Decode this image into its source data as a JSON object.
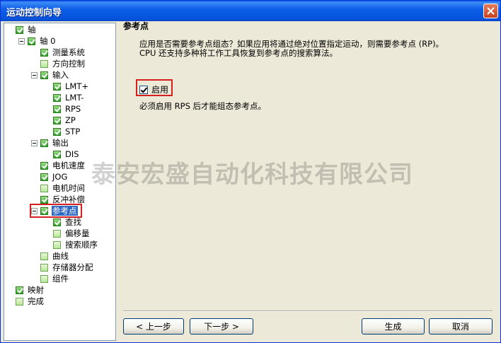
{
  "window": {
    "title": "运动控制向导"
  },
  "tree": [
    {
      "label": "轴",
      "checked": true,
      "depth": 0
    },
    {
      "label": "轴 0",
      "checked": true,
      "depth": 1
    },
    {
      "label": "测量系统",
      "checked": true,
      "depth": 2
    },
    {
      "label": "方向控制",
      "checked": false,
      "depth": 2
    },
    {
      "label": "输入",
      "checked": true,
      "depth": 2
    },
    {
      "label": "LMT+",
      "checked": true,
      "depth": 3
    },
    {
      "label": "LMT-",
      "checked": true,
      "depth": 3
    },
    {
      "label": "RPS",
      "checked": true,
      "depth": 3
    },
    {
      "label": "ZP",
      "checked": true,
      "depth": 3
    },
    {
      "label": "STP",
      "checked": true,
      "depth": 3
    },
    {
      "label": "输出",
      "checked": true,
      "depth": 2
    },
    {
      "label": "DIS",
      "checked": true,
      "depth": 3
    },
    {
      "label": "电机速度",
      "checked": true,
      "depth": 2
    },
    {
      "label": "JOG",
      "checked": true,
      "depth": 2
    },
    {
      "label": "电机时间",
      "checked": false,
      "depth": 2
    },
    {
      "label": "反冲补偿",
      "checked": true,
      "depth": 2
    },
    {
      "label": "参考点",
      "checked": true,
      "depth": 2,
      "selected": true
    },
    {
      "label": "查找",
      "checked": true,
      "depth": 3
    },
    {
      "label": "偏移量",
      "checked": false,
      "depth": 3
    },
    {
      "label": "搜索顺序",
      "checked": false,
      "depth": 3
    },
    {
      "label": "曲线",
      "checked": false,
      "depth": 2
    },
    {
      "label": "存储器分配",
      "checked": false,
      "depth": 2
    },
    {
      "label": "组件",
      "checked": false,
      "depth": 2
    },
    {
      "label": "映射",
      "checked": true,
      "depth": 0
    },
    {
      "label": "完成",
      "checked": false,
      "depth": 0
    }
  ],
  "panel": {
    "title": "参考点",
    "description_line1": "应用是否需要参考点组态？如果应用将通过绝对位置指定运动，则需要参考点 (RP)。",
    "description_line2": "CPU 还支持多种将工作工具恢复到参考点的搜索算法。",
    "enable_label": "启用",
    "enable_checked": true,
    "note": "必须启用 RPS 后才能组态参考点。"
  },
  "watermark": "泰安宏盛自动化科技有限公司",
  "buttons": {
    "prev": "< 上一步",
    "next": "下一步 >",
    "generate": "生成",
    "cancel": "取消"
  },
  "colors": {
    "titlebar": "#0553dd",
    "selection": "#316ac5",
    "highlight_box": "#d62020"
  }
}
